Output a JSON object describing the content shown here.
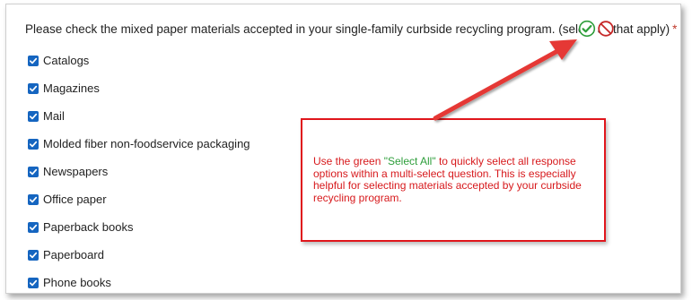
{
  "question": {
    "text": "Please check the mixed paper materials accepted in your single-family curbside recycling program. (select all that apply)",
    "required_marker": "*"
  },
  "actions": {
    "select_all_icon": "check-circle-icon",
    "clear_all_icon": "prohibited-circle-icon"
  },
  "options": [
    {
      "label": "Catalogs",
      "checked": true
    },
    {
      "label": "Magazines",
      "checked": true
    },
    {
      "label": "Mail",
      "checked": true
    },
    {
      "label": "Molded fiber non-foodservice packaging",
      "checked": true
    },
    {
      "label": "Newspapers",
      "checked": true
    },
    {
      "label": "Office paper",
      "checked": true
    },
    {
      "label": "Paperback books",
      "checked": true
    },
    {
      "label": "Paperboard",
      "checked": true
    },
    {
      "label": "Phone books",
      "checked": true
    }
  ],
  "callout": {
    "text_before": "Use the green ",
    "highlight": "\"Select All\"",
    "text_after": " to quickly select all response options within a multi-select question.  This is especially helpful for selecting materials accepted by your curbside recycling program."
  },
  "colors": {
    "accent_red": "#e0161c",
    "select_all_green": "#2e9e3b",
    "clear_red": "#c62828",
    "checkbox_blue": "#1565c0"
  }
}
